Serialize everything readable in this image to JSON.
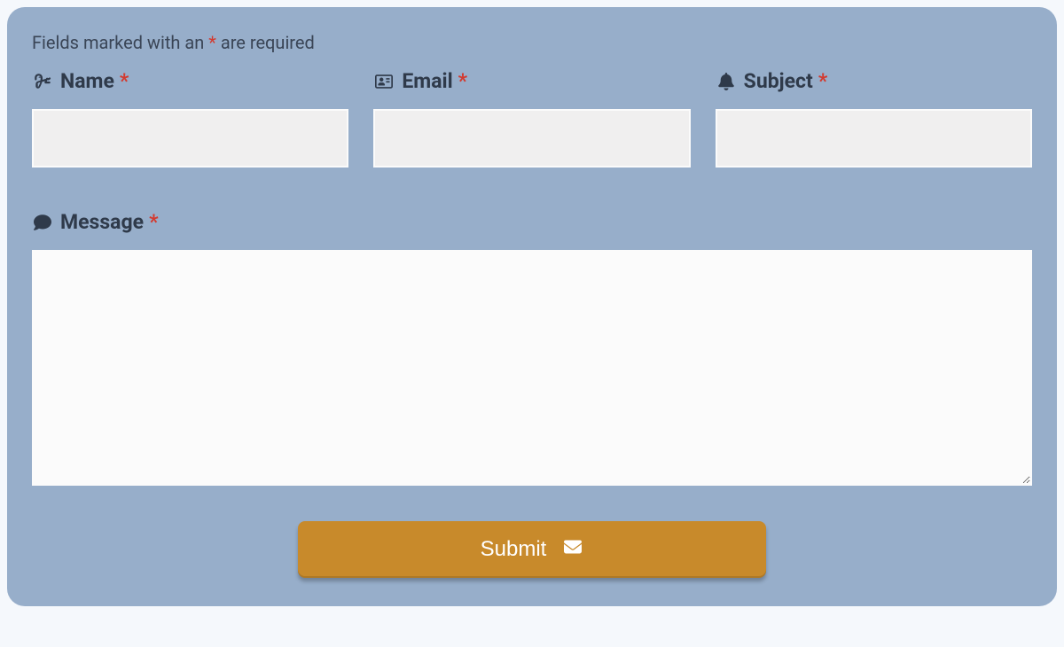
{
  "form": {
    "required_note_prefix": "Fields marked with an ",
    "required_note_asterisk": "*",
    "required_note_suffix": " are required",
    "fields": {
      "name": {
        "label": "Name",
        "required_mark": "*",
        "value": ""
      },
      "email": {
        "label": "Email",
        "required_mark": "*",
        "value": ""
      },
      "subject": {
        "label": "Subject",
        "required_mark": "*",
        "value": ""
      },
      "message": {
        "label": "Message",
        "required_mark": "*",
        "value": ""
      }
    },
    "submit_label": "Submit"
  },
  "colors": {
    "panel_bg": "#97aeca",
    "button_bg": "#c88a2b",
    "text": "#2f3a4a",
    "required": "#d33a2f",
    "input_bg": "#f0efef",
    "textarea_bg": "#fbfbfb"
  }
}
